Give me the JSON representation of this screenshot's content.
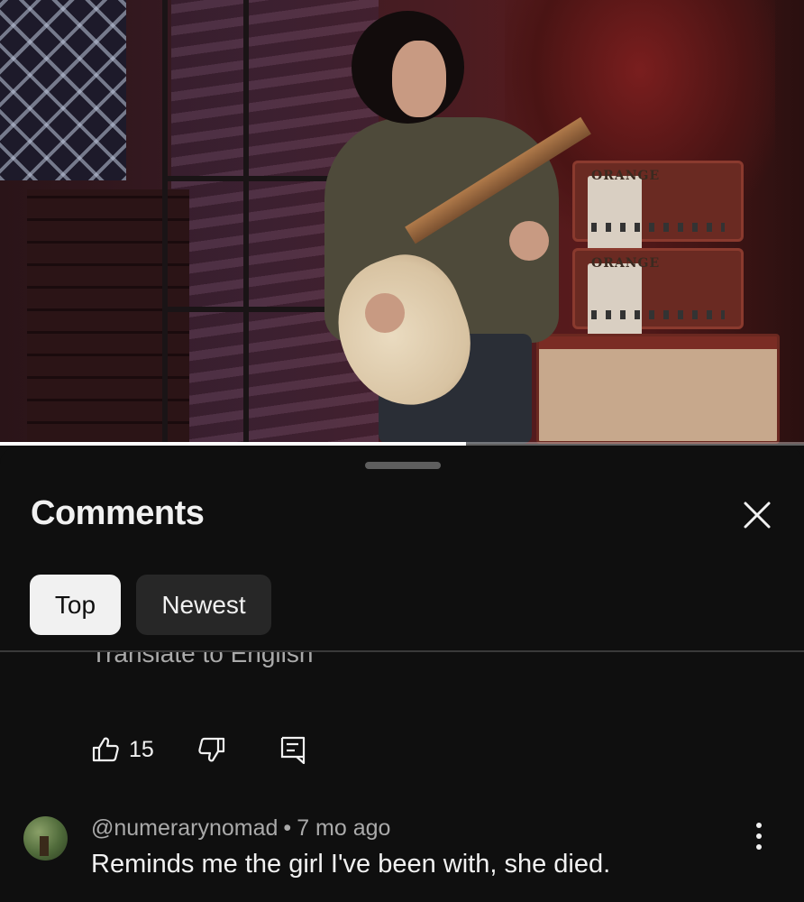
{
  "video": {
    "progress_fraction": 0.58,
    "amp_brand": "ORANGE"
  },
  "comments_sheet": {
    "title": "Comments",
    "filters": [
      {
        "label": "Top",
        "selected": true
      },
      {
        "label": "Newest",
        "selected": false
      }
    ],
    "previous_comment": {
      "translate_label": "Translate to English",
      "like_count": "15"
    },
    "comment": {
      "author": "@numerarynomad",
      "separator": "•",
      "age": "7 mo ago",
      "text": "Reminds me the girl I've been with, she died."
    }
  },
  "icons": [
    "close-icon",
    "like-icon",
    "dislike-icon",
    "reply-icon",
    "more-vert-icon"
  ]
}
